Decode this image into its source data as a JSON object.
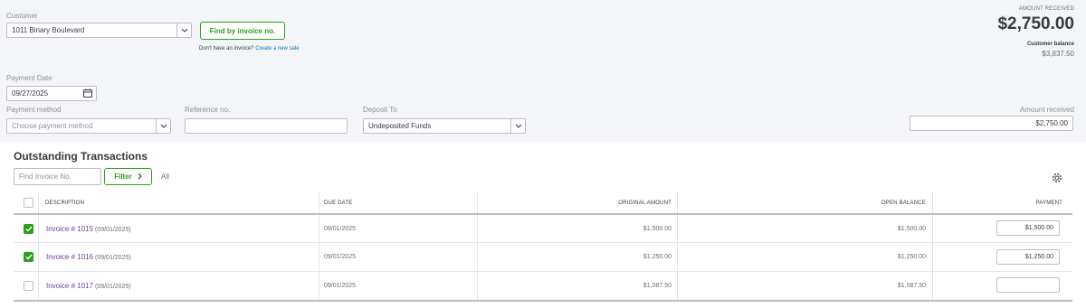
{
  "customer": {
    "label": "Customer",
    "value": "1011 Binary Boulevard"
  },
  "find_invoice_button": "Find by invoice no.",
  "no_invoice_note": "Don't have an invoice?",
  "create_sale_link": "Create a new sale",
  "amount_received_header": {
    "label": "AMOUNT RECEIVED",
    "value": "$2,750.00"
  },
  "customer_balance": {
    "label": "Customer balance",
    "value": "$3,837.50"
  },
  "payment_date": {
    "label": "Payment Date",
    "value": "09/27/2025"
  },
  "payment_method": {
    "label": "Payment method",
    "placeholder": "Choose payment method"
  },
  "reference_no": {
    "label": "Reference no.",
    "value": ""
  },
  "deposit_to": {
    "label": "Deposit To",
    "value": "Undeposited Funds"
  },
  "amount_received_field": {
    "label": "Amount received",
    "value": "$2,750.00"
  },
  "outstanding": {
    "title": "Outstanding Transactions",
    "search_placeholder": "Find Invoice No.",
    "filter_label": "Filter",
    "filter_value": "All",
    "columns": [
      "DESCRIPTION",
      "DUE DATE",
      "ORIGINAL AMOUNT",
      "OPEN BALANCE",
      "PAYMENT"
    ],
    "rows": [
      {
        "checked": true,
        "invoice": "Invoice # 1015",
        "inv_date": "(09/01/2025)",
        "due_date": "09/01/2025",
        "original": "$1,500.00",
        "open": "$1,500.00",
        "payment": "$1,500.00"
      },
      {
        "checked": true,
        "invoice": "Invoice # 1016",
        "inv_date": "(09/01/2025)",
        "due_date": "09/01/2025",
        "original": "$1,250.00",
        "open": "$1,250.00",
        "payment": "$1,250.00"
      },
      {
        "checked": false,
        "invoice": "Invoice # 1017",
        "inv_date": "(09/01/2025)",
        "due_date": "09/01/2025",
        "original": "$1,087.50",
        "open": "$1,087.50",
        "payment": ""
      }
    ]
  },
  "colors": {
    "green": "#2ca01c",
    "link_purple": "#6b3fa0",
    "link_blue": "#0077c5",
    "panel_bg": "#f4f5f8"
  },
  "icons": {
    "dropdown": "chevron-down-icon",
    "calendar": "calendar-icon",
    "settings": "gear-icon",
    "filter_arrow": "chevron-right-icon",
    "check": "check-icon"
  }
}
